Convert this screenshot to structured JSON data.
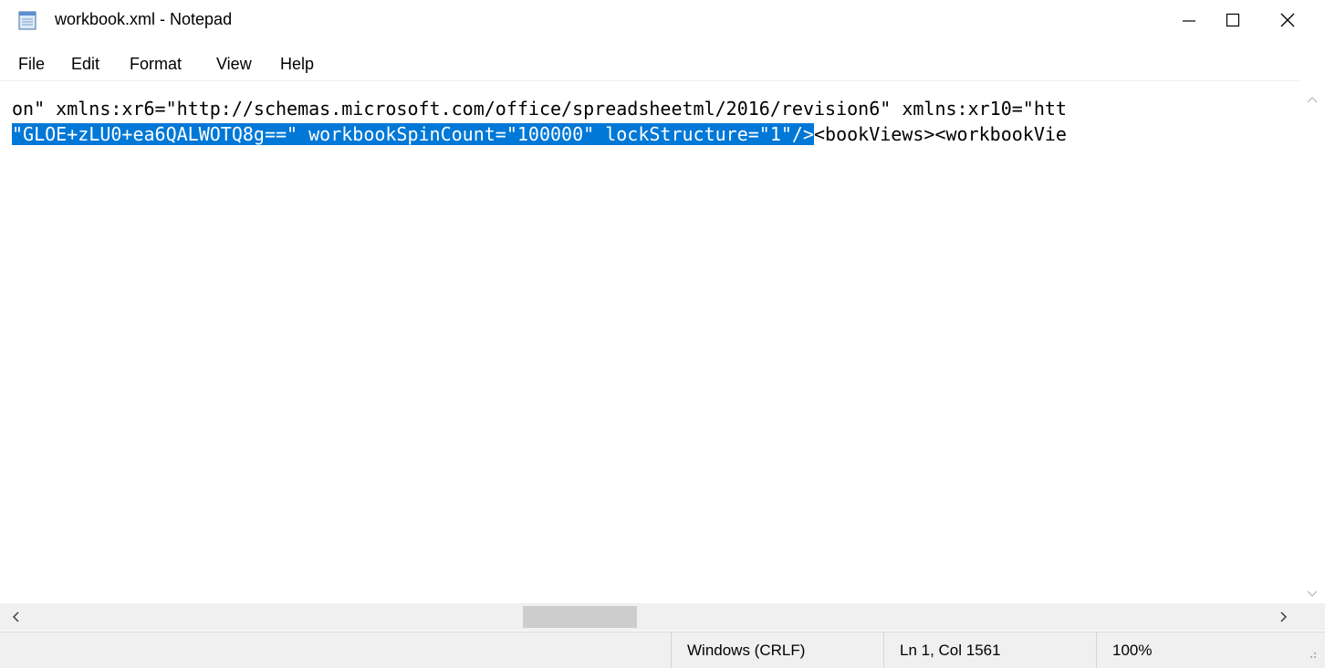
{
  "window": {
    "title": "workbook.xml - Notepad",
    "icon": "notepad-icon",
    "controls": [
      "minimize-icon",
      "maximize-icon",
      "close-icon"
    ]
  },
  "menu": {
    "items": [
      "File",
      "Edit",
      "Format",
      "View",
      "Help"
    ]
  },
  "editor": {
    "line1": "on\" xmlns:xr6=\"http://schemas.microsoft.com/office/spreadsheetml/2016/revision6\" xmlns:xr10=\"htt",
    "line2_selected": "\"GLOE+zLU0+ea6QALWOTQ8g==\" workbookSpinCount=\"100000\" lockStructure=\"1\"/>",
    "line2_rest": "<bookViews><workbookVie",
    "selection_color": "#0078d7"
  },
  "status": {
    "line_ending": "Windows (CRLF)",
    "position": "Ln 1, Col 1561",
    "zoom": "100%"
  }
}
